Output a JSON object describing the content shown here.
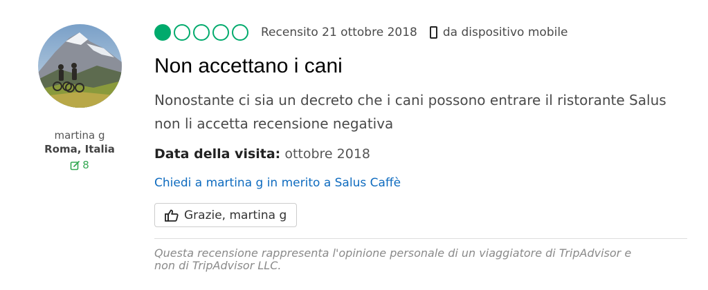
{
  "user": {
    "avatar_icon": "avatar-mountain-bikers-photo",
    "name": "martina g",
    "location": "Roma, Italia",
    "contributions_icon": "edit-icon",
    "contributions": "8"
  },
  "review": {
    "rating": 1,
    "rating_max": 5,
    "rating_color": "#00aa6c",
    "reviewed_date": "Recensito 21 ottobre 2018",
    "device_icon": "mobile-phone-icon",
    "device_text": "da dispositivo mobile",
    "title": "Non accettano i cani",
    "body": "Nonostante ci sia un decreto che i cani possono entrare il ristorante Salus non li accetta recensione negativa",
    "visit_label": "Data della visita:",
    "visit_value": "ottobre 2018",
    "ask_link": "Chiedi a martina g in merito a Salus Caffè",
    "thanks_icon": "thumbs-up-icon",
    "thanks_button": "Grazie, martina g",
    "disclaimer": "Questa recensione rappresenta l'opinione personale di un viaggiatore di TripAdvisor e non di TripAdvisor LLC."
  }
}
